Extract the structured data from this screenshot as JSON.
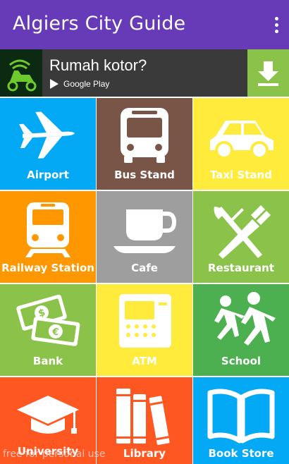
{
  "app": {
    "title": "Algiers City Guide",
    "menu_icon": "overflow-menu-icon"
  },
  "ad": {
    "headline": "Rumah kotor?",
    "store_label": "Google Play",
    "download_icon": "download-icon",
    "accent": "#8BC34A"
  },
  "categories": [
    {
      "id": "airport",
      "label": "Airport",
      "icon": "airplane-icon",
      "color": "#03A9F4"
    },
    {
      "id": "bus-stand",
      "label": "Bus Stand",
      "icon": "bus-icon",
      "color": "#795548"
    },
    {
      "id": "taxi-stand",
      "label": "Taxi Stand",
      "icon": "car-icon",
      "color": "#FFEB3B"
    },
    {
      "id": "railway-station",
      "label": "Railway Station",
      "icon": "train-icon",
      "color": "#FF9800"
    },
    {
      "id": "cafe",
      "label": "Cafe",
      "icon": "coffee-cup-icon",
      "color": "#9E9E9E"
    },
    {
      "id": "restaurant",
      "label": "Restaurant",
      "icon": "fork-knife-icon",
      "color": "#8BC34A"
    },
    {
      "id": "bank",
      "label": "Bank",
      "icon": "money-icon",
      "color": "#8BC34A"
    },
    {
      "id": "atm",
      "label": "ATM",
      "icon": "atm-icon",
      "color": "#FFEB3B"
    },
    {
      "id": "school",
      "label": "School",
      "icon": "children-icon",
      "color": "#4CAF50"
    },
    {
      "id": "university",
      "label": "University",
      "icon": "graduation-cap-icon",
      "color": "#FF5722"
    },
    {
      "id": "library",
      "label": "Library",
      "icon": "books-icon",
      "color": "#FF5722"
    },
    {
      "id": "book-store",
      "label": "Book Store",
      "icon": "open-book-icon",
      "color": "#03A9F4"
    }
  ],
  "watermark": "free for personal use"
}
